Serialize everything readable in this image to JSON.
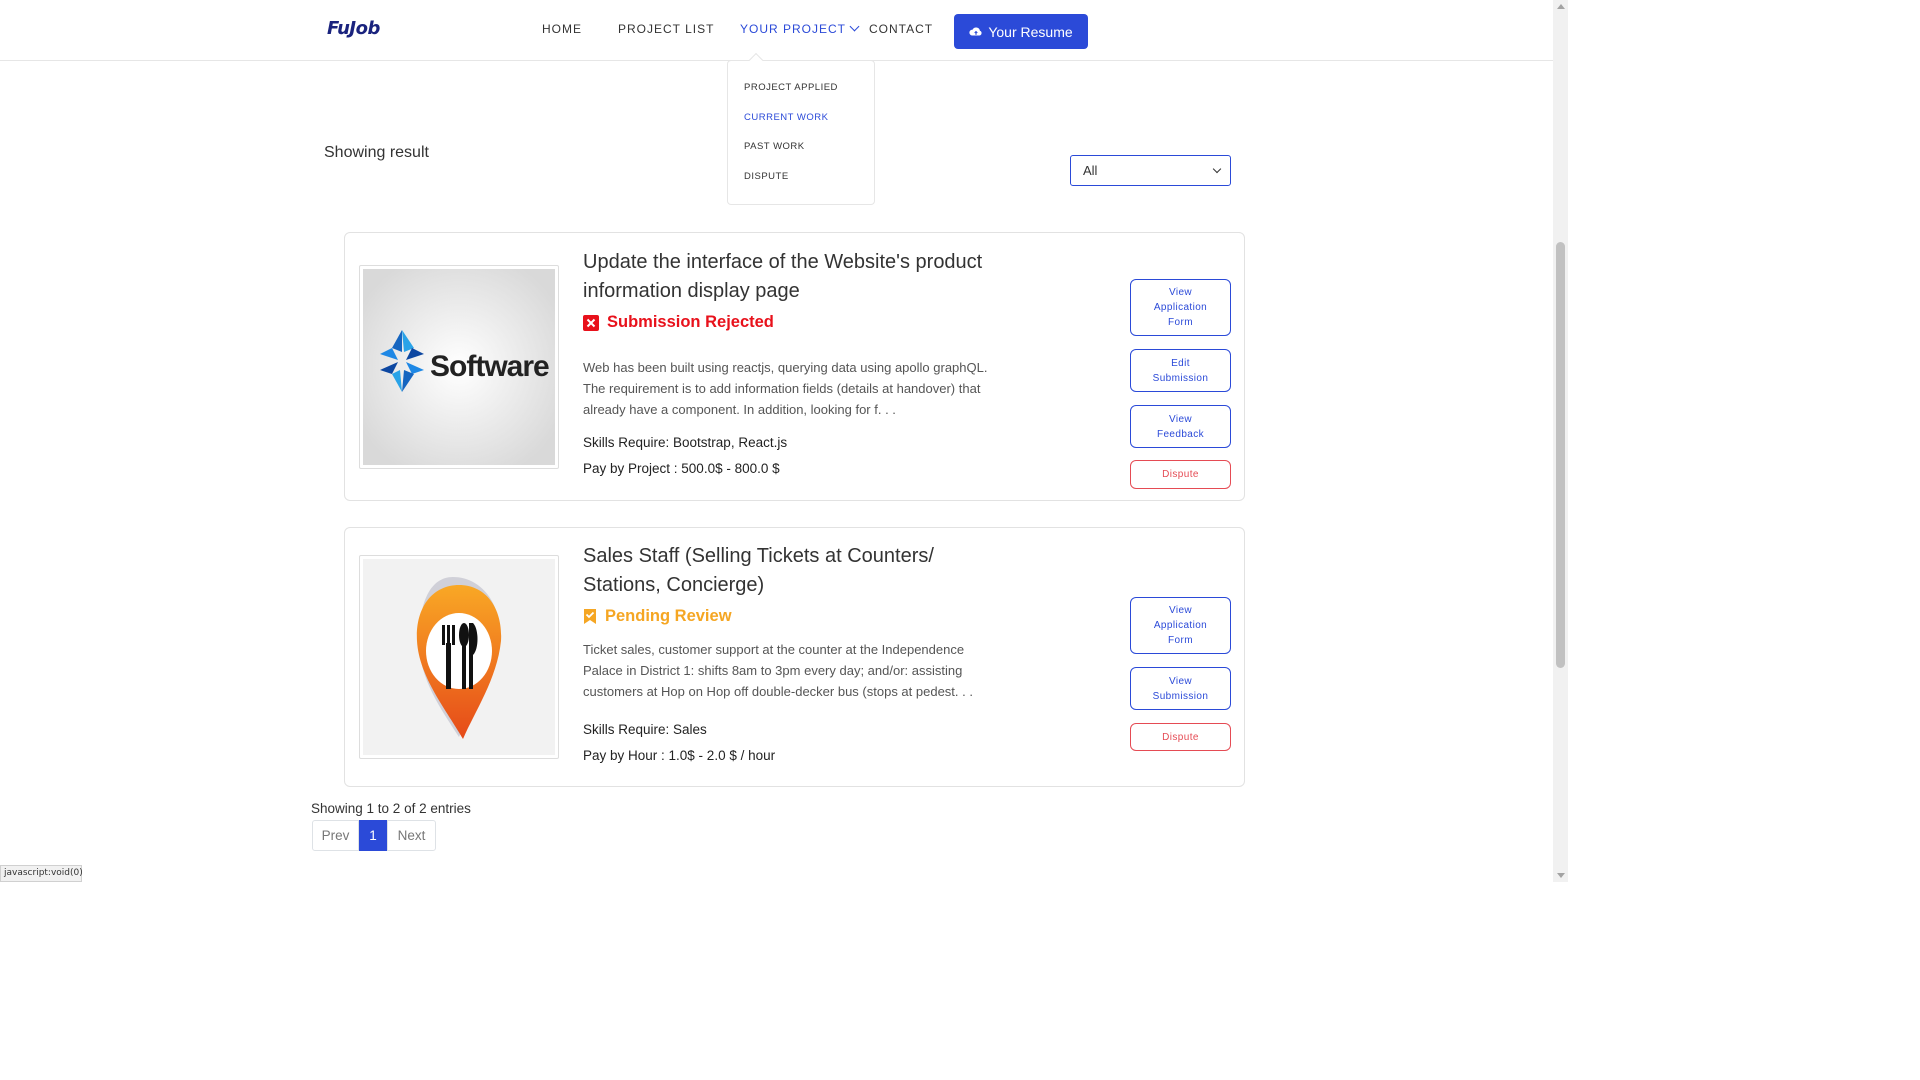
{
  "header": {
    "logo": "FuJob",
    "nav": [
      "HOME",
      "PROJECT LIST",
      "YOUR PROJECT",
      "CONTACT"
    ],
    "active_nav": "YOUR PROJECT",
    "resume_label": "Your Resume"
  },
  "dropdown": {
    "items": [
      "PROJECT APPLIED",
      "CURRENT WORK",
      "PAST WORK",
      "DISPUTE"
    ],
    "active": "CURRENT WORK"
  },
  "filter": {
    "heading": "Showing result",
    "selected": "All"
  },
  "projects": [
    {
      "logo_text": "Software",
      "title": "Update the interface of the Website's product information display page",
      "status": "Submission Rejected",
      "status_color": "#e8111b",
      "description": "Web has been built using reactjs, querying data using apollo graphQL. The requirement is to add information fields (details at handover) that already have a component. In addition, looking for f. . .",
      "skills": "Skills Require: Bootstrap, React.js",
      "pay": "Pay by Project : 500.0$ - 800.0 $",
      "buttons": [
        "View Application Form",
        "Edit Submission",
        "View Feedback",
        "Dispute"
      ]
    },
    {
      "title": "Sales Staff (Selling Tickets at Counters/ Stations, Concierge)",
      "status": "Pending Review",
      "status_color": "#f5a623",
      "description": "Ticket sales, customer support at the counter at the Independence Palace in District 1: shifts 8am to 3pm every day; and/or: assisting customers at Hop on Hop off double-decker bus (stops at pedest. . .",
      "skills": "Skills Require: Sales",
      "pay": "Pay by Hour : 1.0$ - 2.0 $ / hour",
      "buttons": [
        "View Application Form",
        "View Submission",
        "Dispute"
      ]
    }
  ],
  "pagination": {
    "summary": "Showing 1 to 2 of 2 entries",
    "prev": "Prev",
    "current": "1",
    "next": "Next"
  },
  "statusbar": "javascript:void(0)",
  "colors": {
    "accent": "#2b4ad8",
    "danger": "#e54b54"
  }
}
